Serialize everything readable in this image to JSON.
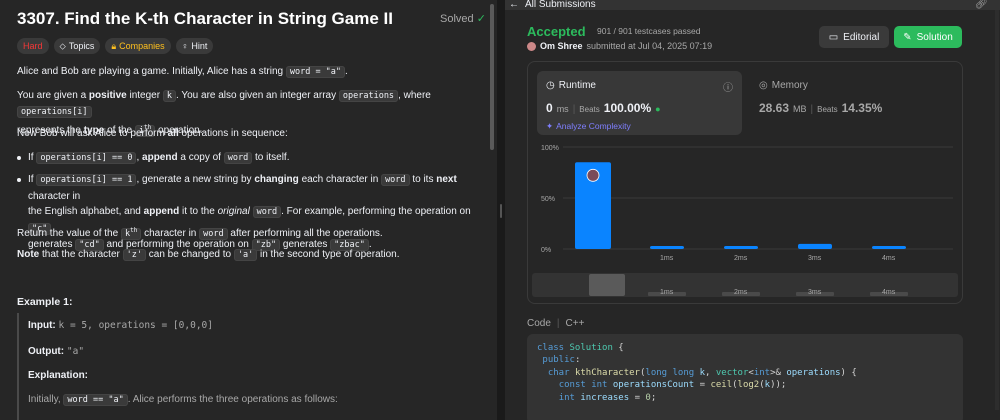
{
  "problem": {
    "title": "3307. Find the K-th Character in String Game II",
    "status": "Solved",
    "difficulty": "Hard",
    "tags": {
      "topics": "Topics",
      "companies": "Companies",
      "hint": "Hint"
    },
    "description": {
      "p1_text": "Alice and Bob are playing a game. Initially, Alice has a string",
      "p1_code": "word = \"a\"",
      "p2_a": "You are given a",
      "p2_bold": "positive",
      "p2_b": "integer",
      "p2_code1": "k",
      "p2_c": ". You are also given an integer array",
      "p2_code2": "operations",
      "p2_d": ", where",
      "p2_code3": "operations[i]",
      "p2_e": "represents the",
      "p2_bold2": "type",
      "p2_f": "of the",
      "p2_code4": "i",
      "p2_sup": "th",
      "p2_g": "operation.",
      "p3_a": "Now Bob will ask Alice to perform",
      "p3_bold": "all",
      "p3_b": "operations in sequence:",
      "b1_a": "If",
      "b1_code": "operations[i] == 0",
      "b1_b": ",",
      "b1_bold": "append",
      "b1_c": "a copy of",
      "b1_code2": "word",
      "b1_d": "to itself.",
      "b2_a": "If",
      "b2_code": "operations[i] == 1",
      "b2_b": ", generate a new string by",
      "b2_bold": "changing",
      "b2_c": "each character in",
      "b2_code2": "word",
      "b2_d": "to its",
      "b2_bold2": "next",
      "b2_e": "character in",
      "b2_f": "the English alphabet, and",
      "b2_bold3": "append",
      "b2_g": "it to the",
      "b2_italic": "original",
      "b2_code3": "word",
      "b2_h": ". For example, performing the operation on",
      "b2_code4": "\"c\"",
      "b2_i": "generates",
      "b2_code5": "\"cd\"",
      "b2_j": "and performing the operation on",
      "b2_code6": "\"zb\"",
      "b2_k": "generates",
      "b2_code7": "\"zbac\"",
      "b2_l": ".",
      "p4_a": "Return the value of the",
      "p4_code": "k",
      "p4_sup": "th",
      "p4_b": "character in",
      "p4_code2": "word",
      "p4_c": "after performing all the operations.",
      "p5_bold": "Note",
      "p5_a": "that the character",
      "p5_code": "'z'",
      "p5_b": "can be changed to",
      "p5_code2": "'a'",
      "p5_c": "in the second type of operation."
    },
    "example": {
      "title": "Example 1:",
      "input_label": "Input:",
      "input_value": "k = 5, operations = [0,0,0]",
      "output_label": "Output:",
      "output_value": "\"a\"",
      "explanation_label": "Explanation:",
      "expl_a": "Initially,",
      "expl_code": "word == \"a\"",
      "expl_b": ". Alice performs the three operations as follows:"
    }
  },
  "submission": {
    "back_label": "All Submissions",
    "status": "Accepted",
    "testcases": "901 / 901 testcases passed",
    "author": "Om Shree",
    "submitted_text": "submitted at Jul 04, 2025 07:19",
    "editorial_label": "Editorial",
    "solution_label": "Solution",
    "runtime": {
      "label": "Runtime",
      "value": "0",
      "unit": "ms",
      "beats_label": "Beats",
      "beats": "100.00%",
      "analyze_label": "Analyze Complexity"
    },
    "memory": {
      "label": "Memory",
      "value": "28.63",
      "unit": "MB",
      "beats_label": "Beats",
      "beats": "14.35%"
    },
    "code_tab": "Code",
    "language": "C++"
  },
  "code_lines": [
    "class Solution {",
    " public:",
    "  char kthCharacter(long long k, vector<int>& operations) {",
    "    const int operationsCount = ceil(log2(k));",
    "    int increases = 0;"
  ],
  "colors": {
    "accepted": "#2cbb5d",
    "hard": "#f63737",
    "bar": "#0a84ff",
    "companies": "#ffc01e"
  },
  "chart_data": {
    "type": "bar",
    "categories": [
      "0ms",
      "1ms",
      "2ms",
      "3ms",
      "4ms"
    ],
    "x_tick_labels": [
      "1ms",
      "2ms",
      "3ms",
      "4ms"
    ],
    "values": [
      85,
      3,
      3,
      5,
      3
    ],
    "ylim": [
      0,
      100
    ],
    "y_ticks": [
      "100%",
      "50%",
      "0%"
    ],
    "highlighted_category": "0ms"
  }
}
